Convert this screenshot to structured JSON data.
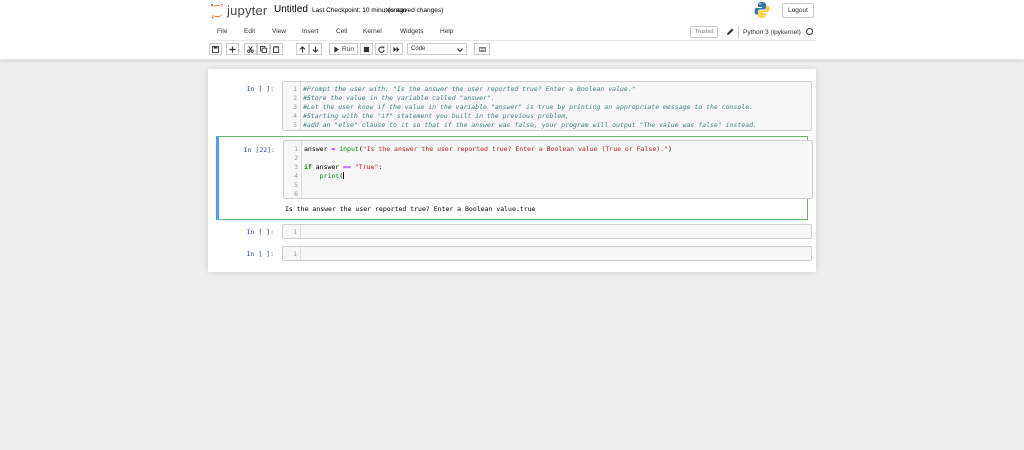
{
  "header": {
    "logo_text": "jupyter",
    "notebook_title": "Untitled",
    "checkpoint_text": "Last Checkpoint: 10 minutes ago",
    "unsaved_text": "(unsaved changes)",
    "logout_label": "Logout"
  },
  "menubar": {
    "items": [
      {
        "label": "File"
      },
      {
        "label": "Edit"
      },
      {
        "label": "View"
      },
      {
        "label": "Insert"
      },
      {
        "label": "Cell"
      },
      {
        "label": "Kernel"
      },
      {
        "label": "Widgets"
      },
      {
        "label": "Help"
      }
    ],
    "trusted_label": "Trusted",
    "kernel_name": "Python 3 (ipykernel)"
  },
  "toolbar": {
    "run_label": "Run",
    "cell_type": "Code",
    "icons": [
      "save-icon",
      "plus-icon",
      "cut-icon",
      "copy-icon",
      "paste-icon",
      "arrow-up-icon",
      "arrow-down-icon",
      "run-icon",
      "stop-icon",
      "restart-icon",
      "fast-forward-icon",
      "keyboard-icon"
    ]
  },
  "cells": [
    {
      "prompt": "In [ ]:",
      "lines": [
        {
          "num": "1",
          "text": "#Prompt the user with: \"Is the answer the user reported true? Enter a Boolean value.\""
        },
        {
          "num": "2",
          "text": "#Store the value in the variable called \"answer\"."
        },
        {
          "num": "3",
          "text": "#Let the user know if the value in the variable \"answer\" is true by printing an appropriate message to the console."
        },
        {
          "num": "4",
          "text": "#Starting with the \"if\" statement you built in the previous problem,"
        },
        {
          "num": "5",
          "text": "#add an \"else\" clause to it so that if the answer was false, your program will output \"The value was false\" instead."
        }
      ]
    },
    {
      "prompt": "In [22]:",
      "lines": [
        {
          "num": "1",
          "p1": "answer",
          "p2": " = ",
          "p3": "input",
          "p4": "(",
          "p5": "\"Is the answer the user reported true? Enter a Boolean value (True or False).\"",
          "p6": ")"
        },
        {
          "num": "2"
        },
        {
          "num": "3",
          "p1": "if",
          "p2": " answer ",
          "p3": "==",
          "p4": " ",
          "p5": "\"True\"",
          "p6": ":"
        },
        {
          "num": "4",
          "p1": "    ",
          "p2": "print",
          "p3": "("
        },
        {
          "num": "5"
        },
        {
          "num": "6"
        }
      ],
      "output": "Is the answer the user reported true? Enter a Boolean value.true"
    },
    {
      "prompt": "In [ ]:",
      "lines": [
        {
          "num": "1"
        }
      ]
    },
    {
      "prompt": "In [ ]:",
      "lines": [
        {
          "num": "1"
        }
      ]
    }
  ]
}
